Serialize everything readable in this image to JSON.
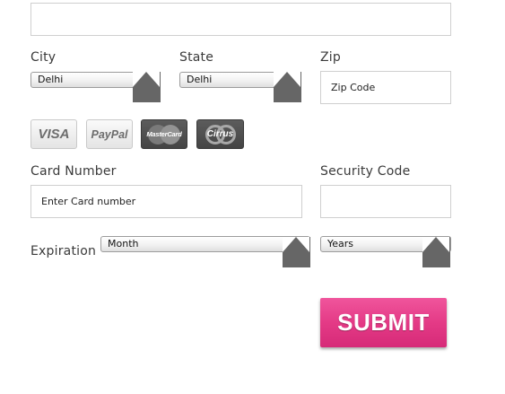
{
  "address": {
    "value": ""
  },
  "city": {
    "label": "City",
    "selected": "Delhi"
  },
  "state": {
    "label": "State",
    "selected": "Delhi"
  },
  "zip": {
    "label": "Zip",
    "placeholder": "Zip Code"
  },
  "cards": {
    "visa": "VISA",
    "paypal": "PayPal",
    "mastercard": "MasterCard",
    "cirrus": "Cirrus"
  },
  "card_number": {
    "label": "Card Number",
    "placeholder": "Enter Card number"
  },
  "security_code": {
    "label": "Security Code",
    "value": ""
  },
  "expiration": {
    "label": "Expiration",
    "month_selected": "Month",
    "year_selected": "Years"
  },
  "submit": {
    "label": "SUBMIT",
    "color": "#e43a86"
  },
  "colors": {
    "label_text": "#3a3a3a",
    "input_border": "#cfcfcf",
    "select_arrow": "#666666"
  }
}
